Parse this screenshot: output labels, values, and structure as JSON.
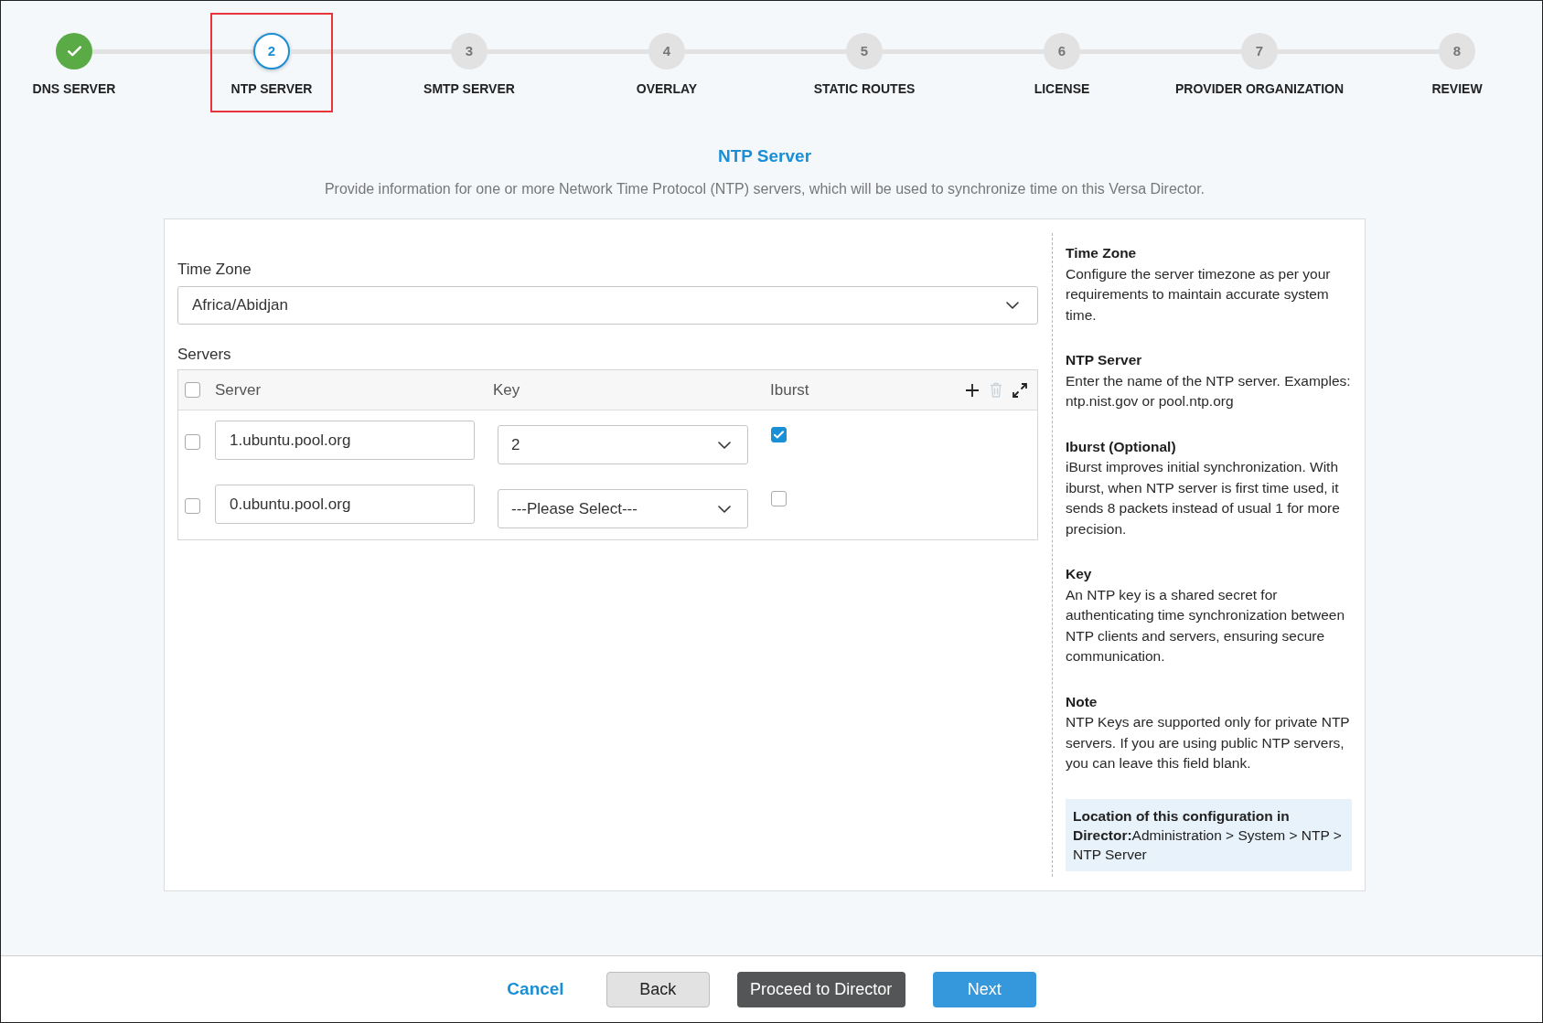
{
  "stepper": {
    "steps": [
      {
        "label": "DNS SERVER",
        "complete": true,
        "selected": false,
        "highlighted": false
      },
      {
        "number": "2",
        "label": "NTP SERVER",
        "complete": false,
        "selected": true,
        "highlighted": true
      },
      {
        "number": "3",
        "label": "SMTP SERVER",
        "complete": false,
        "selected": false,
        "highlighted": false
      },
      {
        "number": "4",
        "label": "OVERLAY",
        "complete": false,
        "selected": false,
        "highlighted": false
      },
      {
        "number": "5",
        "label": "STATIC ROUTES",
        "complete": false,
        "selected": false,
        "highlighted": false
      },
      {
        "number": "6",
        "label": "LICENSE",
        "complete": false,
        "selected": false,
        "highlighted": false
      },
      {
        "number": "7",
        "label": "PROVIDER ORGANIZATION",
        "complete": false,
        "selected": false,
        "highlighted": false
      },
      {
        "number": "8",
        "label": "REVIEW",
        "complete": false,
        "selected": false,
        "highlighted": false
      }
    ]
  },
  "page": {
    "title": "NTP Server",
    "description": "Provide information for one or more Network Time Protocol (NTP) servers, which will be used to synchronize time on this Versa Director."
  },
  "form": {
    "time_zone": {
      "label": "Time Zone",
      "value": "Africa/Abidjan"
    },
    "servers": {
      "label": "Servers",
      "select_all": {
        "checked": false
      },
      "columns": [
        "Server",
        "Key",
        "Iburst"
      ],
      "actions": [
        {
          "kind": "add",
          "disabled": false
        },
        {
          "kind": "delete",
          "disabled": true
        },
        {
          "kind": "expand",
          "disabled": false
        }
      ],
      "rows": [
        {
          "checked": false,
          "server": "1.ubuntu.pool.org",
          "key": "2",
          "iburst": true
        },
        {
          "checked": false,
          "server": "0.ubuntu.pool.org",
          "key": "---Please Select---",
          "iburst": false
        }
      ]
    }
  },
  "help": {
    "sections": [
      {
        "heading": "Time Zone",
        "text": "Configure the server timezone as per your requirements to maintain accurate system time."
      },
      {
        "heading": "NTP Server",
        "text": "Enter the name of the NTP server. Examples: ntp.nist.gov or pool.ntp.org"
      },
      {
        "heading": "Iburst (Optional)",
        "text": "iBurst improves initial synchronization. With iburst, when NTP server is first time used, it sends 8 packets instead of usual 1 for more precision."
      },
      {
        "heading": "Key",
        "text": "An NTP key is a shared secret for authenticating time synchronization between NTP clients and servers, ensuring secure communication."
      },
      {
        "heading": "Note",
        "text": "NTP Keys are supported only for private NTP servers. If you are using public NTP servers, you can leave this field blank."
      }
    ],
    "location": "**Location of this configuration in Director:**Administration > System > NTP > NTP Server"
  },
  "footer": {
    "buttons": [
      {
        "label": "Cancel",
        "kind": "link"
      },
      {
        "label": "Back",
        "kind": "secondary"
      },
      {
        "label": "Proceed to Director",
        "kind": "dark"
      },
      {
        "label": "Next",
        "kind": "primary"
      }
    ]
  }
}
